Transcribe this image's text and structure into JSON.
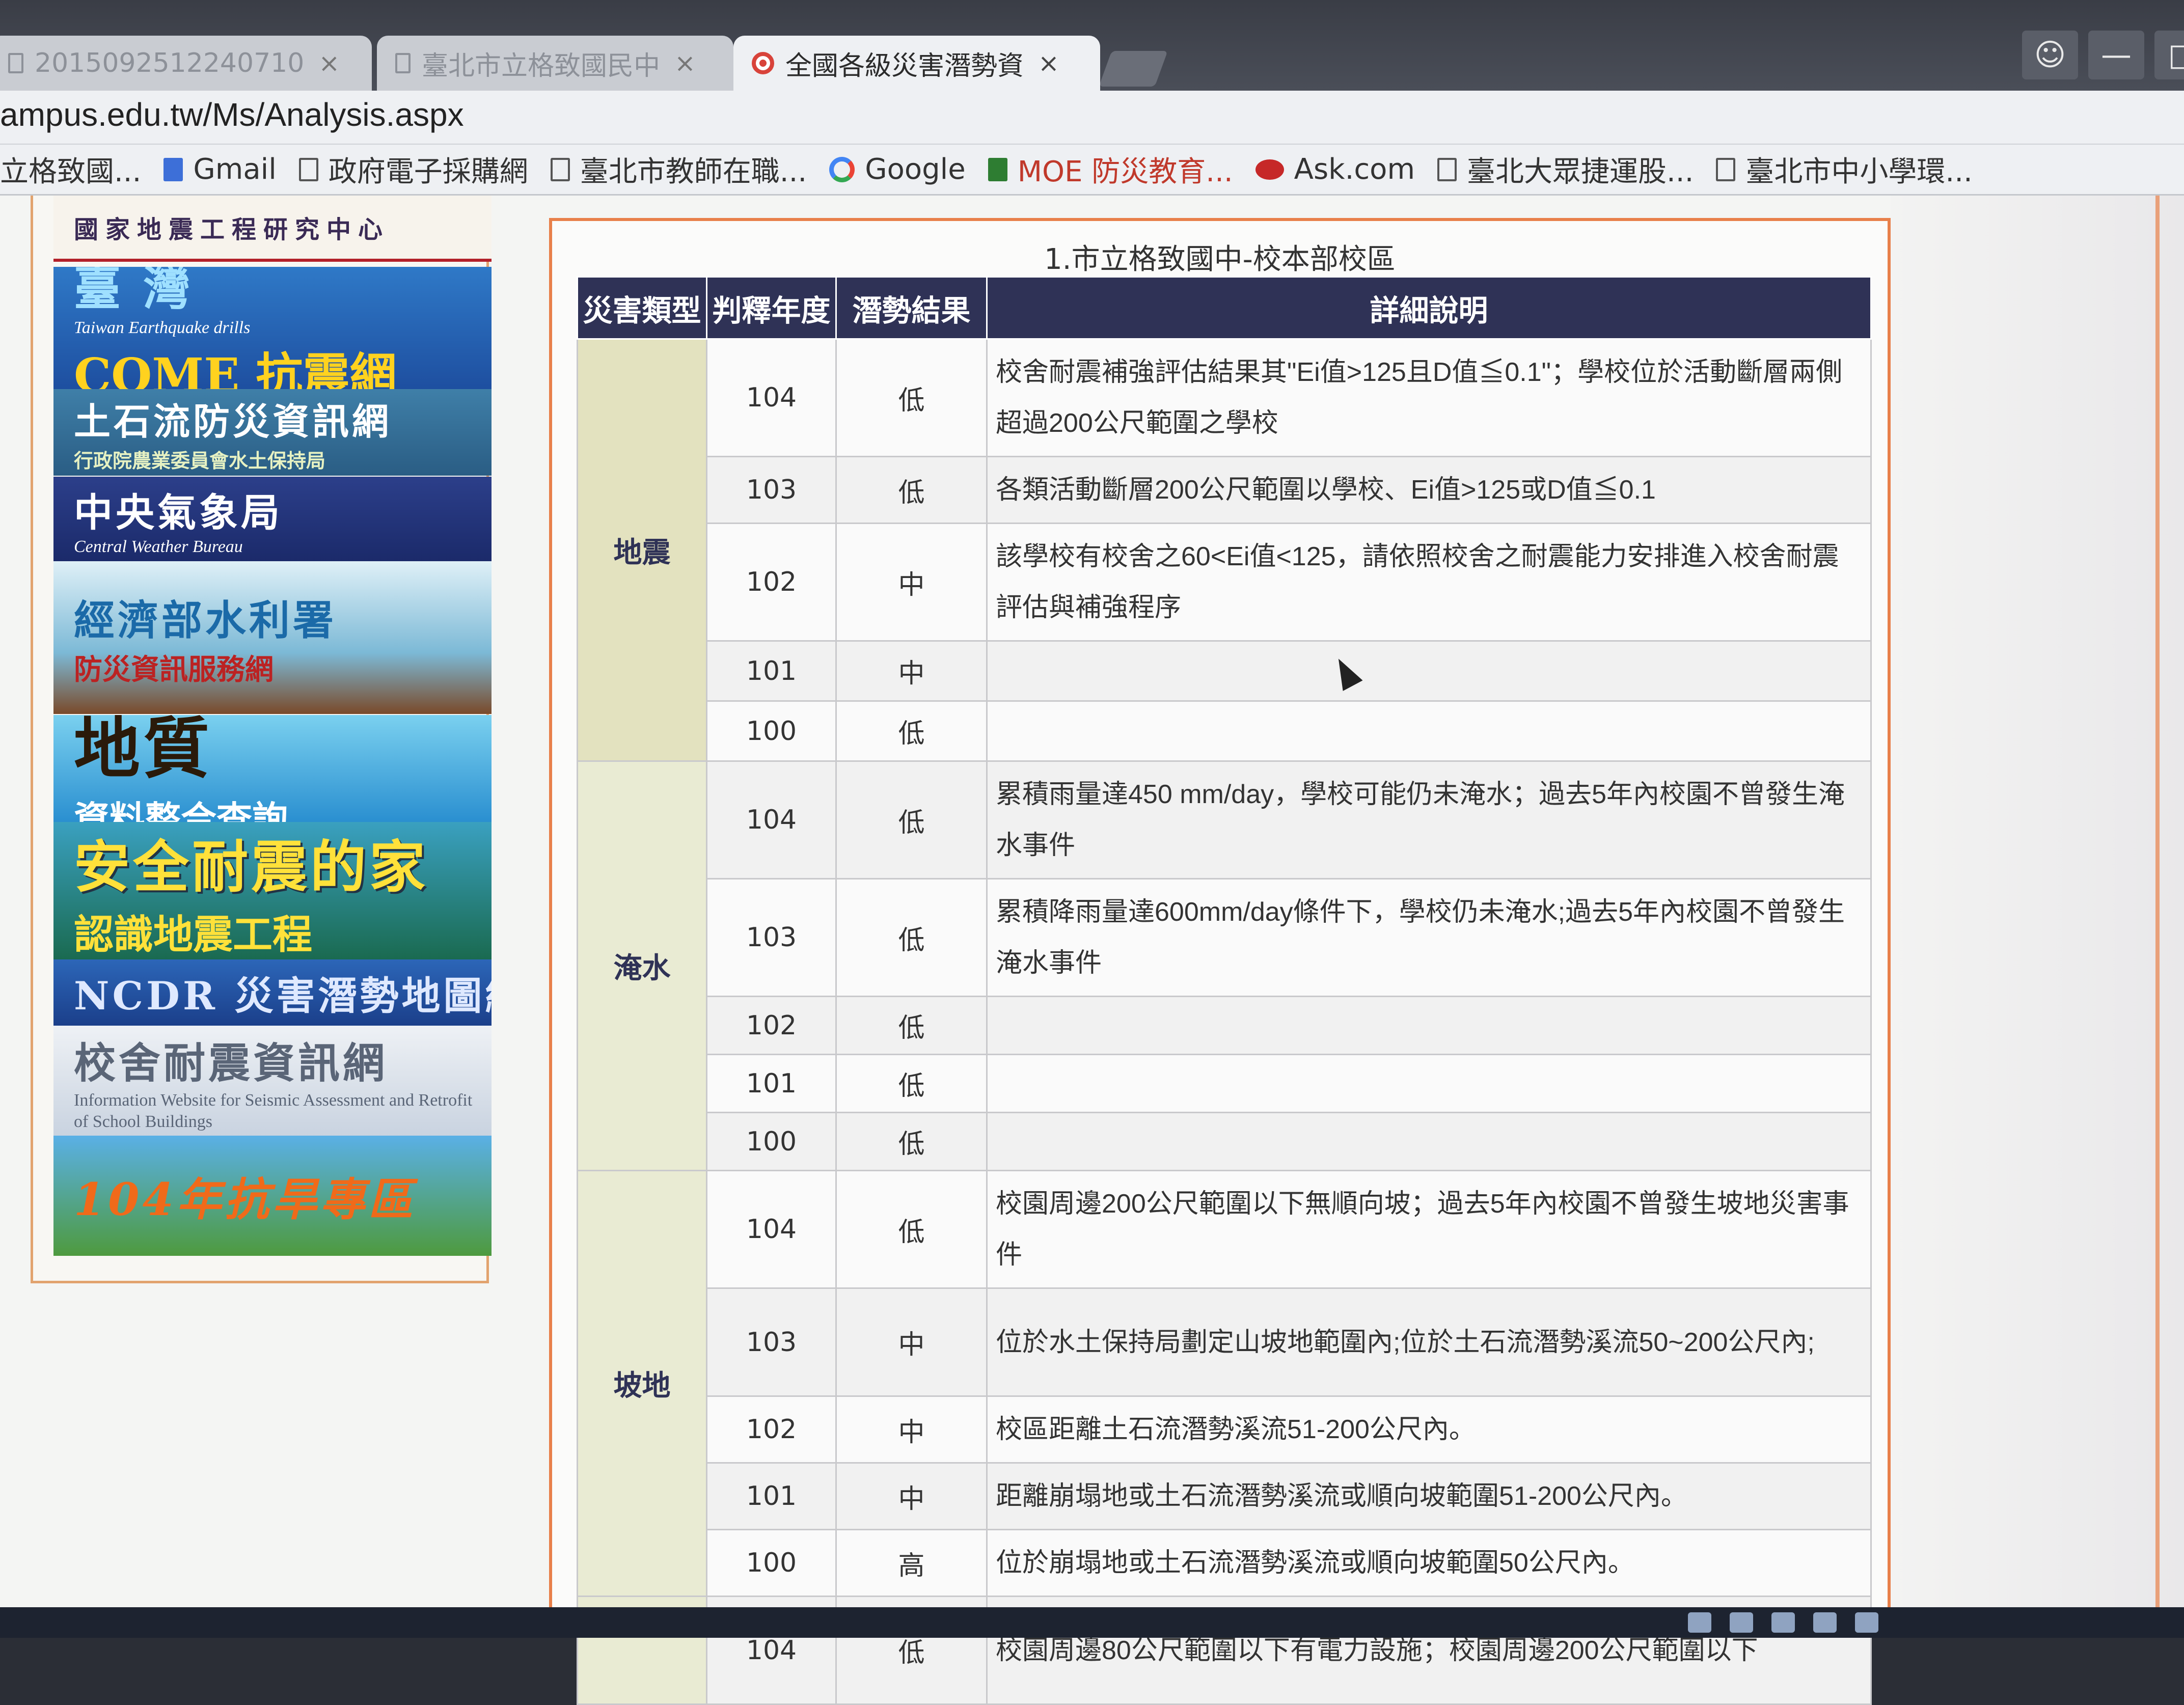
{
  "browser": {
    "tabs": [
      {
        "title": "2015092512240710",
        "active": false
      },
      {
        "title": "臺北市立格致國民中",
        "active": false
      },
      {
        "title": "全國各級災害潛勢資",
        "active": true
      }
    ],
    "close_glyph": "×",
    "url": "ampus.edu.tw/Ms/Analysis.aspx",
    "bookmarks": [
      {
        "label": "立格致國...",
        "icon": "page-icon"
      },
      {
        "label": "Gmail",
        "icon": "gmail-icon"
      },
      {
        "label": "政府電子採購網",
        "icon": "page-icon"
      },
      {
        "label": "臺北市教師在職...",
        "icon": "page-icon"
      },
      {
        "label": "Google",
        "icon": "google-icon"
      },
      {
        "label": "MOE 防災教育...",
        "icon": "moe-icon"
      },
      {
        "label": "Ask.com",
        "icon": "ask-icon"
      },
      {
        "label": "臺北大眾捷運股...",
        "icon": "page-icon"
      },
      {
        "label": "臺北市中小學環...",
        "icon": "page-icon"
      }
    ]
  },
  "sidebar": {
    "banners": [
      {
        "main": "國家地震工程研究中心"
      },
      {
        "main": "臺 灣",
        "sub": "Taiwan Earthquake drills",
        "sub2": "COME 抗震網"
      },
      {
        "main": "土石流防災資訊網",
        "sub": "行政院農業委員會水土保持局"
      },
      {
        "main": "中央氣象局",
        "en": "Central Weather Bureau"
      },
      {
        "main": "經濟部水利署",
        "sub": "防災資訊服務網"
      },
      {
        "main": "地質",
        "sub": "資料整合查詢"
      },
      {
        "main": "安全耐震的家",
        "sub": "認識地震工程"
      },
      {
        "main": "NCDR 災害潛勢地圖網站"
      },
      {
        "main": "校舍耐震資訊網",
        "en": "Information Website for Seismic Assessment and Retrofit of School Buildings"
      },
      {
        "main": "104年抗旱專區"
      }
    ]
  },
  "report": {
    "title": "1.市立格致國中-校本部校區",
    "headers": [
      "災害類型",
      "判釋年度",
      "潛勢結果",
      "詳細說明"
    ],
    "groups": [
      {
        "type": "地震",
        "rows": [
          {
            "year": "104",
            "result": "低",
            "detail": "校舍耐震補強評估結果其\"Ei值>125且D值≦0.1\"；學校位於活動斷層兩側超過200公尺範圍之學校"
          },
          {
            "year": "103",
            "result": "低",
            "detail": "各類活動斷層200公尺範圍以學校、Ei值>125或D值≦0.1"
          },
          {
            "year": "102",
            "result": "中",
            "detail": "該學校有校舍之60<Ei值<125，請依照校舍之耐震能力安排進入校舍耐震評估與補強程序"
          },
          {
            "year": "101",
            "result": "中",
            "detail": ""
          },
          {
            "year": "100",
            "result": "低",
            "detail": ""
          }
        ]
      },
      {
        "type": "淹水",
        "rows": [
          {
            "year": "104",
            "result": "低",
            "detail": "累積雨量達450 mm/day，學校可能仍未淹水；過去5年內校園不曾發生淹水事件"
          },
          {
            "year": "103",
            "result": "低",
            "detail": "累積降雨量達600mm/day條件下，學校仍未淹水;過去5年內校園不曾發生淹水事件"
          },
          {
            "year": "102",
            "result": "低",
            "detail": ""
          },
          {
            "year": "101",
            "result": "低",
            "detail": ""
          },
          {
            "year": "100",
            "result": "低",
            "detail": ""
          }
        ]
      },
      {
        "type": "坡地",
        "rows": [
          {
            "year": "104",
            "result": "低",
            "detail": "校園周邊200公尺範圍以下無順向坡；過去5年內校園不曾發生坡地災害事件"
          },
          {
            "year": "103",
            "result": "中",
            "detail": "位於水土保持局劃定山坡地範圍內;位於土石流潛勢溪流50~200公尺內;"
          },
          {
            "year": "102",
            "result": "中",
            "detail": "校區距離土石流潛勢溪流51-200公尺內。"
          },
          {
            "year": "101",
            "result": "中",
            "detail": "距離崩塌地或土石流潛勢溪流或順向坡範圍51-200公尺內。"
          },
          {
            "year": "100",
            "result": "高",
            "detail": "位於崩塌地或土石流潛勢溪流或順向坡範圍50公尺內。"
          }
        ]
      },
      {
        "type": "",
        "rows": [
          {
            "year": "104",
            "result": "低",
            "detail": "校園周邊80公尺範圍以下有電力設施；校園周邊200公尺範圍以下"
          }
        ]
      }
    ]
  }
}
